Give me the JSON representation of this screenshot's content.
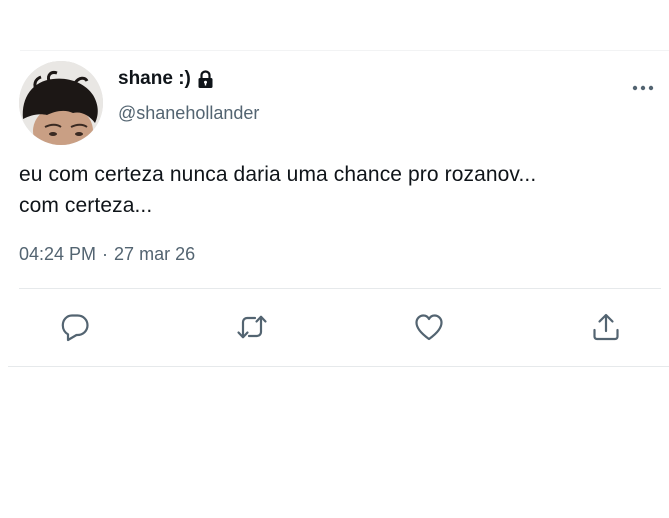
{
  "user": {
    "display_name": "shane :)",
    "handle": "@shanehollander",
    "avatar_icon": "avatar",
    "protected_icon": "lock-icon"
  },
  "tweet": {
    "lines": [
      "eu com certeza nunca daria uma chance pro rozanov...",
      "com certeza..."
    ],
    "time": "04:24 PM",
    "separator": "·",
    "date": "27 mar 26"
  },
  "actions": {
    "icons": [
      "comment-icon",
      "retweet-icon",
      "like-icon",
      "share-icon"
    ]
  },
  "colors": {
    "text_primary": "#0f1419",
    "text_secondary": "#536471",
    "icon": "#536471",
    "divider": "#e6e9eb"
  }
}
